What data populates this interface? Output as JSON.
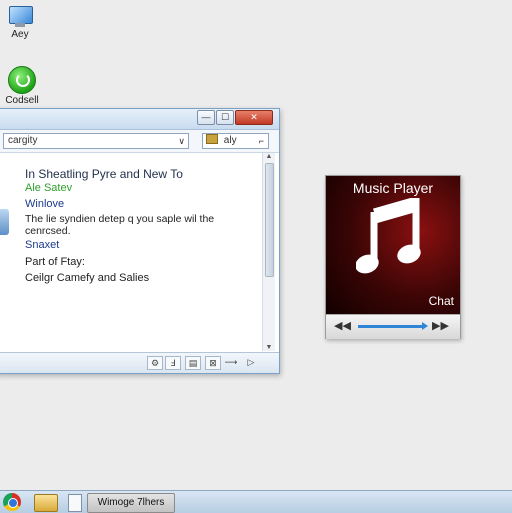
{
  "desktop": {
    "icons": [
      {
        "label": "Aey",
        "icon": "computer-icon"
      },
      {
        "label": "Codsell",
        "icon": "control-icon"
      }
    ]
  },
  "window": {
    "buttons": {
      "minimize": "—",
      "maximize": "☐",
      "close": "✕"
    },
    "search": {
      "value": "cargity",
      "chevron": "∨"
    },
    "view": {
      "value": "aly",
      "ext": "⌐"
    },
    "content": {
      "heading": "In Sheatling Pyre and New To",
      "subheading": "Ale Satev",
      "link1": "Winlove",
      "body": "The lie syndien detep q you saple wil the\ncenrcsed.",
      "link2": "Snaxet",
      "part": "Part of Ftay:",
      "ceiling": "Ceilgr Camefy and Salies"
    },
    "status_icons": [
      "⚙",
      "Ⅎ",
      "▤",
      "⊠",
      "⟶",
      "▷"
    ]
  },
  "player": {
    "title": "Music Player",
    "caption": "Chat",
    "accent": "#2f86d6",
    "controls": {
      "prev": "◀◀",
      "next": "▶▶"
    }
  },
  "taskbar": {
    "active_task": "Wimoge 7lhers"
  }
}
